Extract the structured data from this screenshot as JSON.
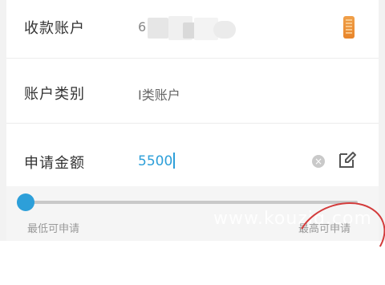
{
  "form": {
    "account": {
      "label": "收款账户",
      "value_masked": "6"
    },
    "account_type": {
      "label": "账户类别",
      "value": "I类账户"
    },
    "amount": {
      "label": "申请金额",
      "value": "5500"
    }
  },
  "slider": {
    "min_label": "最低可申请",
    "max_label": "最高可申请",
    "fraction": 0.0
  },
  "watermark": "www.kouziq.com",
  "icons": {
    "card": "bank-card-icon",
    "clear": "clear-icon",
    "edit": "edit-icon"
  },
  "colors": {
    "accent": "#2d9fd9",
    "card": "#e8852a",
    "annotation": "#d33b3b"
  }
}
